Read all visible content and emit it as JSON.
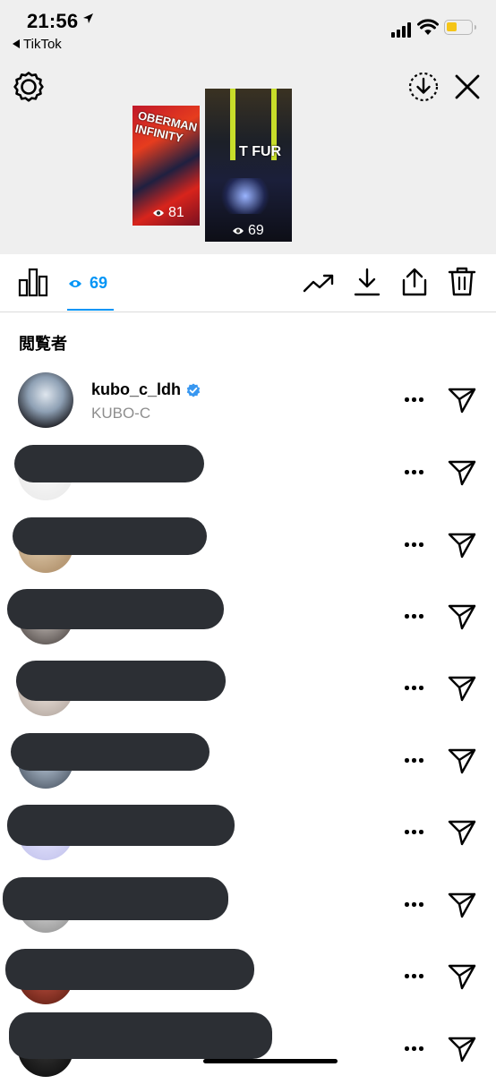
{
  "status": {
    "time": "21:56",
    "back_app": "TikTok",
    "battery_color": "#f5c518"
  },
  "header": {
    "left_icon": "settings-gear-icon",
    "right_icons": [
      "download-circle-icon",
      "close-icon"
    ]
  },
  "stories": [
    {
      "views": "81",
      "overlay": "OBERMAN INFINITY",
      "current": false
    },
    {
      "views": "69",
      "overlay": "T FUR",
      "current": true
    }
  ],
  "toolbar": {
    "views_count": "69",
    "accent": "#0095f6",
    "icons": [
      "bar-chart-icon",
      "eye-icon",
      "insights-trend-icon",
      "download-icon",
      "share-icon",
      "trash-icon"
    ]
  },
  "viewers_title": "閲覧者",
  "viewers": [
    {
      "username": "kubo_c_ldh",
      "fullname": "KUBO-C",
      "verified": true
    },
    {
      "username": "",
      "fullname": "",
      "verified": false
    },
    {
      "username": "",
      "fullname": "",
      "verified": false
    },
    {
      "username": "",
      "fullname": "",
      "verified": false
    },
    {
      "username": "",
      "fullname": "",
      "verified": false
    },
    {
      "username": "",
      "fullname": "",
      "verified": false
    },
    {
      "username": "",
      "fullname": "",
      "verified": false
    },
    {
      "username": "",
      "fullname": "",
      "verified": false
    },
    {
      "username": "",
      "fullname": "",
      "verified": false
    },
    {
      "username": "",
      "fullname": "",
      "verified": false
    }
  ]
}
